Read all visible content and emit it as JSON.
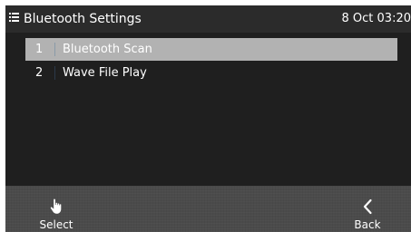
{
  "header": {
    "icon": "menu-icon",
    "title": "Bluetooth Settings",
    "date_time": "8 Oct 03:20"
  },
  "menu": {
    "items": [
      {
        "number": "1",
        "label": "Bluetooth Scan",
        "selected": true
      },
      {
        "number": "2",
        "label": "Wave File Play",
        "selected": false
      }
    ]
  },
  "softkeys": {
    "select": {
      "label": "Select",
      "icon": "hand-pointer-icon"
    },
    "back": {
      "label": "Back",
      "icon": "chevron-left-icon"
    }
  },
  "colors": {
    "screen_background": "#1f1f1f",
    "header_background": "#2b2b2b",
    "selected_row": "#b2b2b2",
    "softkey_bar": "#4b4b4b",
    "text": "#ffffff"
  }
}
